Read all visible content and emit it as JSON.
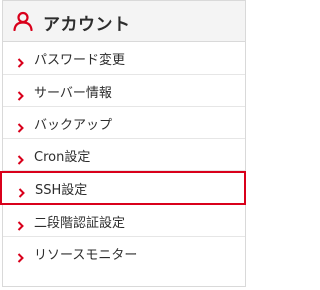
{
  "header": {
    "title": "アカウント",
    "icon": "user-outline-icon",
    "accent_color": "#d9001b"
  },
  "menu": {
    "items": [
      {
        "label": "パスワード変更",
        "icon": "chevron-right-icon",
        "active": false
      },
      {
        "label": "サーバー情報",
        "icon": "chevron-right-icon",
        "active": false
      },
      {
        "label": "バックアップ",
        "icon": "chevron-right-icon",
        "active": false
      },
      {
        "label": "Cron設定",
        "icon": "chevron-right-icon",
        "active": false
      },
      {
        "label": "SSH設定",
        "icon": "chevron-right-icon",
        "active": true
      },
      {
        "label": "二段階認証設定",
        "icon": "chevron-right-icon",
        "active": false
      },
      {
        "label": "リソースモニター",
        "icon": "chevron-right-icon",
        "active": false
      }
    ]
  }
}
